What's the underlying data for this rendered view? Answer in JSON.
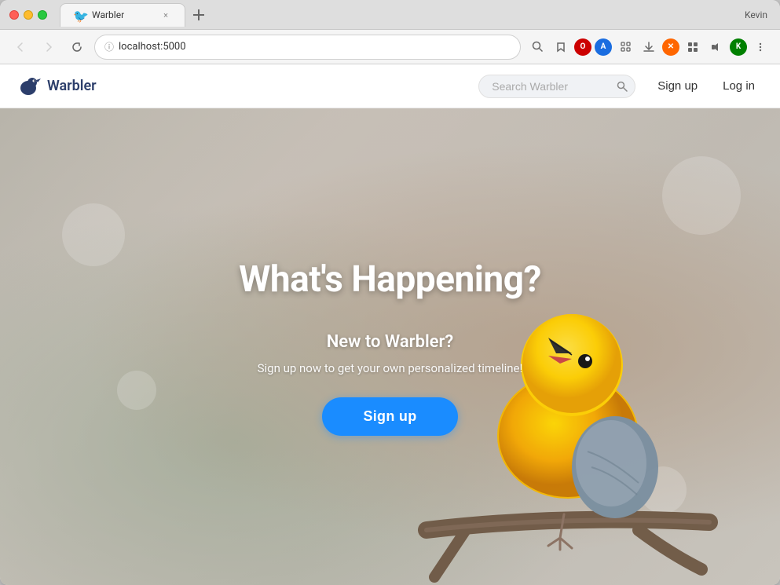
{
  "browser": {
    "title_bar": {
      "user": "Kevin",
      "tab": {
        "title": "Warbler",
        "favicon": "🐦"
      },
      "close_icon": "×"
    },
    "nav_bar": {
      "address": "localhost:5000",
      "address_icon": "ⓘ"
    }
  },
  "app": {
    "logo": {
      "text": "Warbler"
    },
    "search": {
      "placeholder": "Search Warbler"
    },
    "nav": {
      "signup_label": "Sign up",
      "login_label": "Log in"
    },
    "hero": {
      "title": "What's Happening?",
      "subtitle": "New to Warbler?",
      "description": "Sign up now to get your own personalized timeline!",
      "cta_label": "Sign up"
    }
  }
}
